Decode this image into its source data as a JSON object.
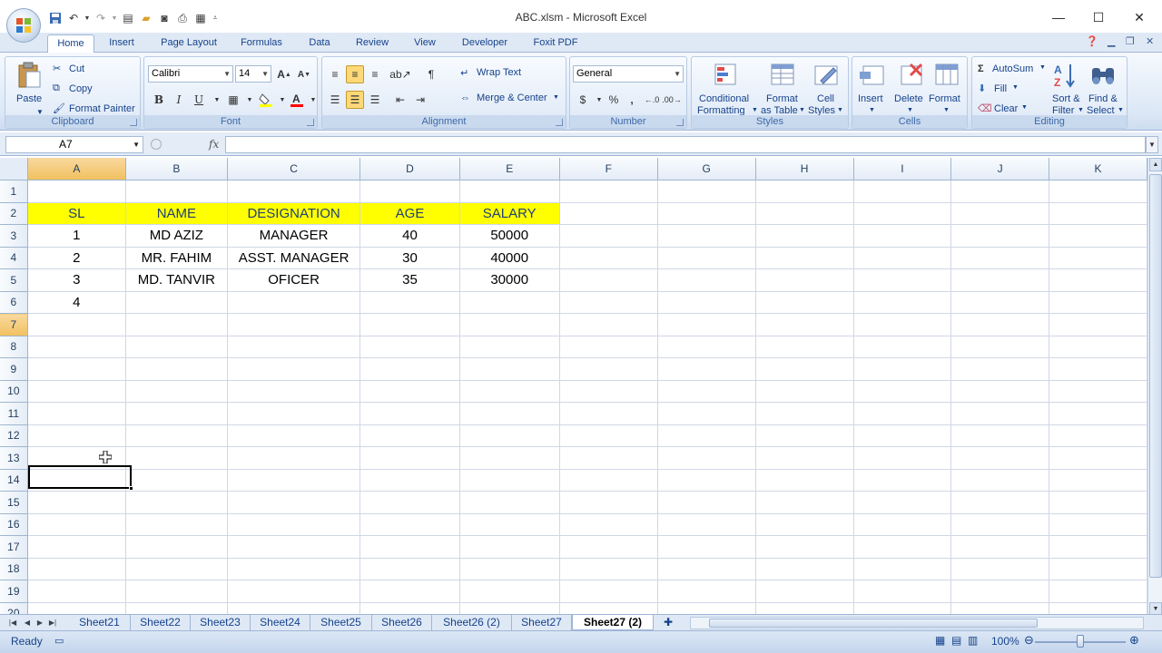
{
  "window": {
    "title": "ABC.xlsm - Microsoft Excel",
    "minimize_icon": "minimize-icon",
    "maximize_icon": "maximize-icon",
    "close_icon": "close-icon"
  },
  "ribbon_tabs": [
    "Home",
    "Insert",
    "Page Layout",
    "Formulas",
    "Data",
    "Review",
    "View",
    "Developer",
    "Foxit PDF"
  ],
  "active_tab": "Home",
  "clipboard": {
    "paste": "Paste",
    "cut": "Cut",
    "copy": "Copy",
    "format_painter": "Format Painter",
    "label": "Clipboard"
  },
  "font": {
    "name": "Calibri",
    "size": "14",
    "bold": "B",
    "italic": "I",
    "underline": "U",
    "label": "Font",
    "fill_color": "#ffff00",
    "font_color": "#ff0000"
  },
  "alignment": {
    "wrap_text": "Wrap Text",
    "merge_center": "Merge & Center",
    "label": "Alignment"
  },
  "number": {
    "format": "General",
    "currency": "$",
    "percent": "%",
    "comma": ",",
    "label": "Number"
  },
  "styles": {
    "conditional": "Conditional",
    "formatting": "Formatting",
    "format": "Format",
    "as_table": "as Table",
    "cell": "Cell",
    "cell_styles": "Styles",
    "label": "Styles"
  },
  "cells": {
    "insert": "Insert",
    "delete": "Delete",
    "format": "Format",
    "label": "Cells"
  },
  "editing": {
    "autosum": "AutoSum",
    "fill": "Fill",
    "clear": "Clear",
    "sort": "Sort &",
    "filter": "Filter",
    "find": "Find &",
    "select": "Select",
    "label": "Editing"
  },
  "formula_bar": {
    "name_box": "A7",
    "fx": "fx",
    "formula": ""
  },
  "sheet": {
    "columns": [
      "A",
      "B",
      "C",
      "D",
      "E",
      "F",
      "G",
      "H",
      "I",
      "J",
      "K"
    ],
    "active_column": "A",
    "active_row": 7,
    "header_fill": "#ffff00",
    "rows": [
      [
        "",
        "",
        "",
        "",
        "",
        "",
        "",
        "",
        "",
        "",
        ""
      ],
      [
        "SL",
        "NAME",
        "DESIGNATION",
        "AGE",
        "SALARY",
        "",
        "",
        "",
        "",
        "",
        ""
      ],
      [
        "1",
        "MD AZIZ",
        "MANAGER",
        "40",
        "50000",
        "",
        "",
        "",
        "",
        "",
        ""
      ],
      [
        "2",
        "MR. FAHIM",
        "ASST. MANAGER",
        "30",
        "40000",
        "",
        "",
        "",
        "",
        "",
        ""
      ],
      [
        "3",
        "MD. TANVIR",
        "OFICER",
        "35",
        "30000",
        "",
        "",
        "",
        "",
        "",
        ""
      ],
      [
        "4",
        "",
        "",
        "",
        "",
        "",
        "",
        "",
        "",
        "",
        ""
      ],
      [
        "",
        "",
        "",
        "",
        "",
        "",
        "",
        "",
        "",
        "",
        ""
      ],
      [
        "",
        "",
        "",
        "",
        "",
        "",
        "",
        "",
        "",
        "",
        ""
      ],
      [
        "",
        "",
        "",
        "",
        "",
        "",
        "",
        "",
        "",
        "",
        ""
      ],
      [
        "",
        "",
        "",
        "",
        "",
        "",
        "",
        "",
        "",
        "",
        ""
      ],
      [
        "",
        "",
        "",
        "",
        "",
        "",
        "",
        "",
        "",
        "",
        ""
      ],
      [
        "",
        "",
        "",
        "",
        "",
        "",
        "",
        "",
        "",
        "",
        ""
      ],
      [
        "",
        "",
        "",
        "",
        "",
        "",
        "",
        "",
        "",
        "",
        ""
      ],
      [
        "",
        "",
        "",
        "",
        "",
        "",
        "",
        "",
        "",
        "",
        ""
      ],
      [
        "",
        "",
        "",
        "",
        "",
        "",
        "",
        "",
        "",
        "",
        ""
      ],
      [
        "",
        "",
        "",
        "",
        "",
        "",
        "",
        "",
        "",
        "",
        ""
      ],
      [
        "",
        "",
        "",
        "",
        "",
        "",
        "",
        "",
        "",
        "",
        ""
      ],
      [
        "",
        "",
        "",
        "",
        "",
        "",
        "",
        "",
        "",
        "",
        ""
      ],
      [
        "",
        "",
        "",
        "",
        "",
        "",
        "",
        "",
        "",
        "",
        ""
      ],
      [
        "",
        "",
        "",
        "",
        "",
        "",
        "",
        "",
        "",
        "",
        ""
      ]
    ]
  },
  "sheet_tabs": [
    "Sheet21",
    "Sheet22",
    "Sheet23",
    "Sheet24",
    "Sheet25",
    "Sheet26",
    "Sheet26 (2)",
    "Sheet27",
    "Sheet27 (2)"
  ],
  "active_sheet": "Sheet27 (2)",
  "status": {
    "ready": "Ready",
    "zoom": "100%",
    "zoom_fraction": 0.5
  }
}
